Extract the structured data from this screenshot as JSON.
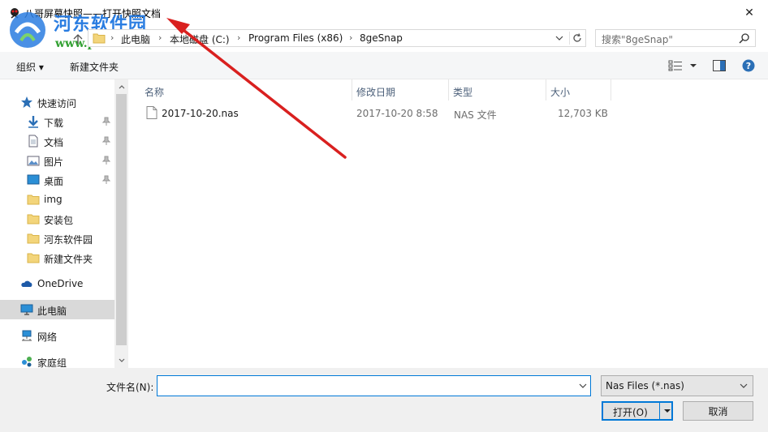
{
  "window": {
    "title": "八哥屏幕快照——打开快照文档",
    "close_glyph": "✕"
  },
  "watermark": {
    "text": "河东软件园",
    "url": "www.pc0359.cn"
  },
  "address": {
    "crumbs": [
      "此电脑",
      "本地磁盘 (C:)",
      "Program Files (x86)",
      "8geSnap"
    ],
    "separator": "›"
  },
  "search": {
    "placeholder": "搜索\"8geSnap\""
  },
  "toolbar": {
    "organize_label": "组织 ▾",
    "new_folder_label": "新建文件夹"
  },
  "sidebar": {
    "quick_access": "快速访问",
    "items": [
      {
        "label": "下载",
        "icon": "download-icon",
        "pinned": true
      },
      {
        "label": "文档",
        "icon": "document-icon",
        "pinned": true
      },
      {
        "label": "图片",
        "icon": "picture-icon",
        "pinned": true
      },
      {
        "label": "桌面",
        "icon": "desktop-icon",
        "pinned": true
      },
      {
        "label": "img",
        "icon": "folder-icon",
        "pinned": false
      },
      {
        "label": "安装包",
        "icon": "folder-icon",
        "pinned": false
      },
      {
        "label": "河东软件园",
        "icon": "folder-icon",
        "pinned": false
      },
      {
        "label": "新建文件夹",
        "icon": "folder-icon",
        "pinned": false
      }
    ],
    "onedrive": "OneDrive",
    "this_pc": "此电脑",
    "network": "网络",
    "homegroup": "家庭组"
  },
  "columns": {
    "name": "名称",
    "modified": "修改日期",
    "type": "类型",
    "size": "大小"
  },
  "files": [
    {
      "name": "2017-10-20.nas",
      "modified": "2017-10-20 8:58",
      "type": "NAS 文件",
      "size": "12,703 KB"
    }
  ],
  "bottom": {
    "filename_label": "文件名(N):",
    "filename_value": "",
    "filter_value": "Nas Files (*.nas)",
    "open_label": "打开(O)",
    "cancel_label": "取消"
  },
  "colors": {
    "accent": "#0078d7",
    "annotation_arrow": "#d9201f",
    "selection": "#d9d9d9"
  }
}
